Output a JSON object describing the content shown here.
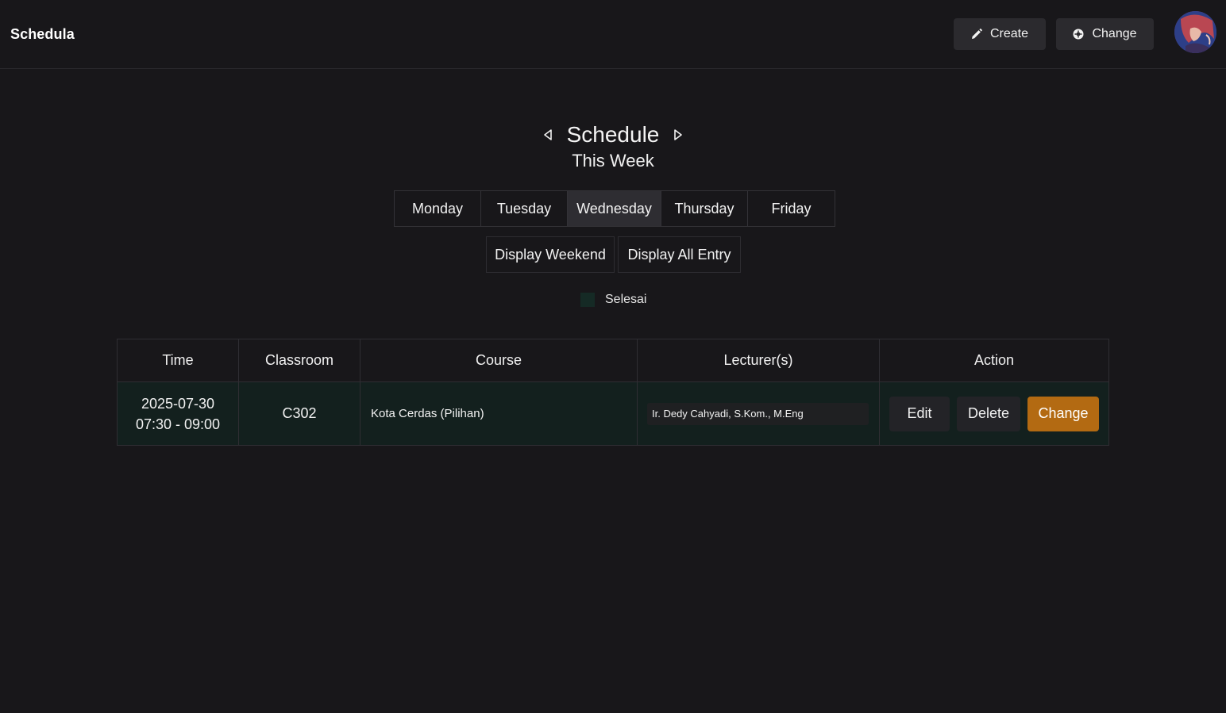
{
  "app": {
    "title": "Schedula"
  },
  "header": {
    "create_label": "Create",
    "change_label": "Change"
  },
  "page": {
    "title": "Schedule",
    "subtitle": "This Week"
  },
  "days": [
    {
      "label": "Monday",
      "active": false
    },
    {
      "label": "Tuesday",
      "active": false
    },
    {
      "label": "Wednesday",
      "active": true
    },
    {
      "label": "Thursday",
      "active": false
    },
    {
      "label": "Friday",
      "active": false
    }
  ],
  "options": {
    "weekend_label": "Display Weekend",
    "all_entry_label": "Display All Entry"
  },
  "legend": {
    "label": "Selesai",
    "color": "#152a25"
  },
  "table": {
    "headers": [
      "Time",
      "Classroom",
      "Course",
      "Lecturer(s)",
      "Action"
    ],
    "rows": [
      {
        "date": "2025-07-30",
        "time": "07:30 - 09:00",
        "classroom": "C302",
        "course": "Kota Cerdas (Pilihan)",
        "lecturers": "Ir. Dedy Cahyadi, S.Kom., M.Eng",
        "actions": {
          "edit": "Edit",
          "delete": "Delete",
          "change": "Change"
        }
      }
    ]
  },
  "colors": {
    "background": "#18171a",
    "accent": "#b36a12",
    "completed_row": "#13201e"
  },
  "icons": {
    "create": "pencil-icon",
    "change": "settings-icon",
    "prev": "triangle-left-icon",
    "next": "triangle-right-icon"
  }
}
